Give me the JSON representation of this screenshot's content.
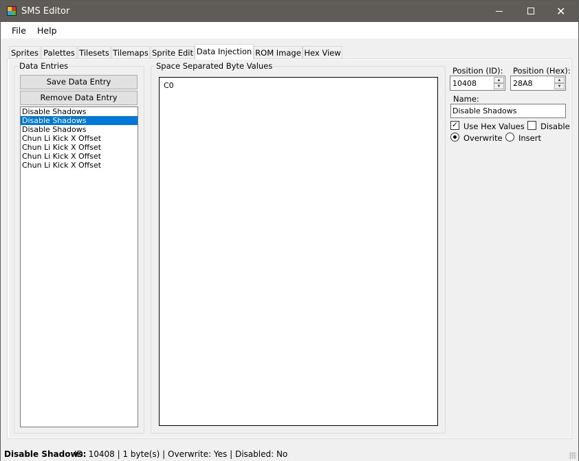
{
  "window": {
    "title": "SMS Editor",
    "minimize_glyph": "",
    "maximize_glyph": "",
    "close_glyph": "✕"
  },
  "menu": {
    "file": "File",
    "help": "Help"
  },
  "tabs": [
    "Sprites",
    "Palettes",
    "Tilesets",
    "Tilemaps",
    "Sprite Edit",
    "Data Injection",
    "ROM Image",
    "Hex View"
  ],
  "active_tab": "Data Injection",
  "data_entries": {
    "group_title": "Data Entries",
    "save_button": "Save Data Entry",
    "remove_button": "Remove Data Entry",
    "items": [
      {
        "label": "Disable Shadows",
        "selected": false
      },
      {
        "label": "Disable Shadows",
        "selected": true
      },
      {
        "label": "Disable Shadows",
        "selected": false
      },
      {
        "label": "Chun Li Kick X Offset",
        "selected": false
      },
      {
        "label": "Chun Li Kick X Offset",
        "selected": false
      },
      {
        "label": "Chun Li Kick X Offset",
        "selected": false
      },
      {
        "label": "Chun Li Kick X Offset",
        "selected": false
      }
    ]
  },
  "byte_values": {
    "group_title": "Space Separated Byte Values",
    "content": "C0"
  },
  "properties": {
    "position_id_label": "Position (ID):",
    "position_id_value": "10408",
    "position_hex_label": "Position (Hex):",
    "position_hex_value": "28A8",
    "name_label": "Name:",
    "name_value": "Disable Shadows",
    "use_hex_label": "Use Hex Values",
    "use_hex_checked": true,
    "disable_label": "Disable",
    "disable_checked": false,
    "overwrite_label": "Overwrite",
    "insert_label": "Insert",
    "mode": "Overwrite"
  },
  "status": {
    "name": "Disable Shadows:",
    "details": "ID: 10408 | 1 byte(s) | Overwrite: Yes | Disabled: No"
  },
  "icons": {
    "app": "app-icon",
    "spin_up": "▲",
    "spin_down": "▼",
    "check": "✓"
  }
}
